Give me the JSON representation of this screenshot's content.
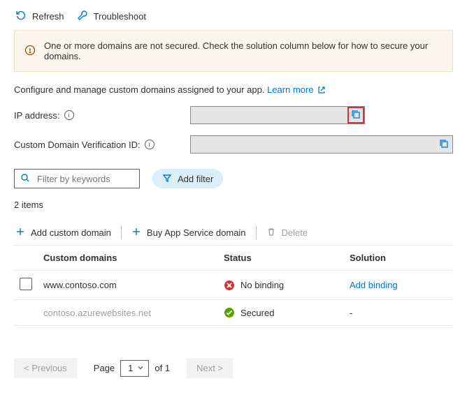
{
  "toolbar": {
    "refresh": "Refresh",
    "troubleshoot": "Troubleshoot"
  },
  "alert": {
    "text": "One or more domains are not secured. Check the solution column below for how to secure your domains."
  },
  "intro": {
    "text": "Configure and manage custom domains assigned to your app.",
    "learn_more": "Learn more"
  },
  "fields": {
    "ip_label": "IP address:",
    "ip_value": "",
    "cdv_label": "Custom Domain Verification ID:",
    "cdv_value": ""
  },
  "filter": {
    "placeholder": "Filter by keywords",
    "add_filter": "Add filter"
  },
  "list": {
    "count_text": "2 items"
  },
  "actions": {
    "add_domain": "Add custom domain",
    "buy_domain": "Buy App Service domain",
    "delete": "Delete"
  },
  "table": {
    "head": {
      "domain": "Custom domains",
      "status": "Status",
      "solution": "Solution"
    },
    "rows": [
      {
        "domain": "www.contoso.com",
        "status_text": "No binding",
        "status_kind": "error",
        "solution": "Add binding",
        "solution_is_link": true,
        "selectable": true
      },
      {
        "domain": "contoso.azurewebsites.net",
        "status_text": "Secured",
        "status_kind": "ok",
        "solution": "-",
        "solution_is_link": false,
        "selectable": false
      }
    ]
  },
  "pager": {
    "prev": "< Previous",
    "page_label": "Page",
    "page_current": "1",
    "page_of": "of 1",
    "next": "Next >"
  }
}
